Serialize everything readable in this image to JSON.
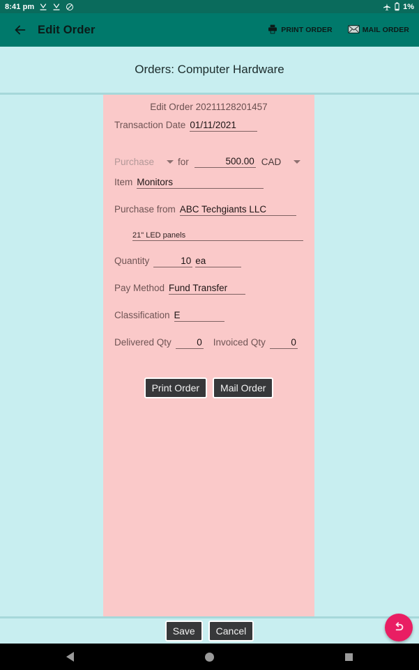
{
  "status_bar": {
    "time": "8:41 pm",
    "icons_left": [
      "download-done-icon",
      "download-done-icon",
      "do-not-disturb-icon"
    ],
    "icons_right": [
      "airplane-mode-icon",
      "battery-icon"
    ],
    "battery_percent": "1%"
  },
  "app_bar": {
    "back_icon": "arrow-back-icon",
    "title": "Edit Order",
    "actions": [
      {
        "icon": "printer-icon",
        "label": "PRINT ORDER"
      },
      {
        "icon": "envelope-icon",
        "label": "MAIL ORDER"
      }
    ]
  },
  "section": {
    "title": "Orders: Computer Hardware"
  },
  "form": {
    "heading": "Edit Order 20211128201457",
    "transaction_date": {
      "label": "Transaction Date",
      "value": "01/11/2021"
    },
    "type": {
      "value": "Purchase",
      "for_label": "for",
      "amount": "500.00",
      "currency": "CAD"
    },
    "item": {
      "label": "Item",
      "value": "Monitors"
    },
    "purchase_from": {
      "label": "Purchase from",
      "value": "ABC Techgiants LLC"
    },
    "description": {
      "value": "21\" LED panels"
    },
    "quantity": {
      "label": "Quantity",
      "value": "10",
      "unit": "ea"
    },
    "pay_method": {
      "label": "Pay Method",
      "value": "Fund Transfer"
    },
    "classification": {
      "label": "Classification",
      "value": "E"
    },
    "delivered_qty": {
      "label": "Delivered Qty",
      "value": "0"
    },
    "invoiced_qty": {
      "label": "Invoiced Qty",
      "value": "0"
    },
    "buttons": {
      "print": "Print Order",
      "mail": "Mail Order"
    }
  },
  "bottom_bar": {
    "save": "Save",
    "cancel": "Cancel",
    "fab_icon": "undo-icon"
  },
  "nav_bar": {
    "back": "back-triangle-icon",
    "home": "home-circle-icon",
    "recents": "recents-square-icon"
  },
  "colors": {
    "status_bar": "#0a6b5c",
    "app_bar": "#00796b",
    "background": "#c8eef0",
    "card": "#fac9c9",
    "fab": "#e91e63",
    "button_dark": "#37383a"
  }
}
